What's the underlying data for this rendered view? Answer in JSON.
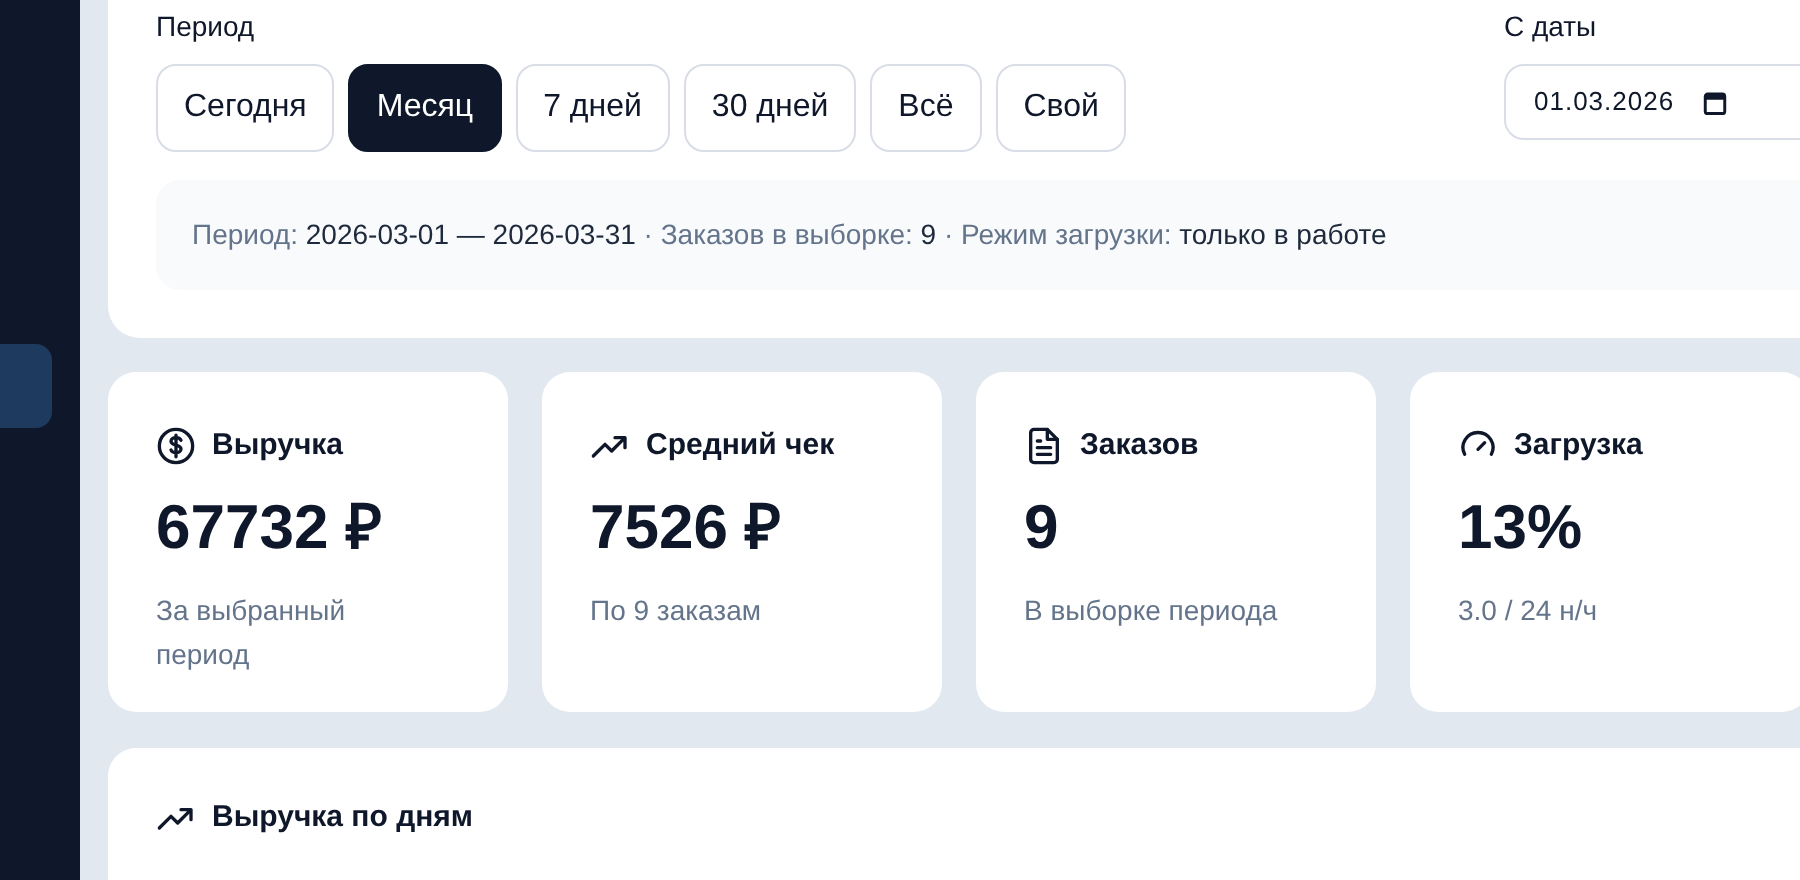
{
  "sidebar": {
    "items": [
      {
        "selected": true
      }
    ]
  },
  "period_filter": {
    "label": "Период",
    "presets": [
      {
        "label": "Сегодня",
        "selected": false
      },
      {
        "label": "Месяц",
        "selected": true
      },
      {
        "label": "7 дней",
        "selected": false
      },
      {
        "label": "30 дней",
        "selected": false
      },
      {
        "label": "Всё",
        "selected": false
      },
      {
        "label": "Свой",
        "selected": false
      }
    ],
    "date_from": {
      "label": "С даты",
      "value": "01.03.2026"
    },
    "summary": [
      {
        "label": "Период:",
        "value": "2026-03-01 — 2026-03-31"
      },
      {
        "label": "· Заказов в выборке:",
        "value": "9"
      },
      {
        "label": "· Режим загрузки:",
        "value": "только в работе"
      }
    ]
  },
  "stats": [
    {
      "kind": "revenue",
      "title": "Выручка",
      "value": "67732 ₽",
      "caption": "За выбранный период"
    },
    {
      "kind": "average",
      "title": "Средний чек",
      "value": "7526 ₽",
      "caption": "По 9 заказам"
    },
    {
      "kind": "orders",
      "title": "Заказов",
      "value": "9",
      "caption": "В выборке периода"
    },
    {
      "kind": "load",
      "title": "Загрузка",
      "value": "13%",
      "caption": "3.0 / 24 н/ч"
    }
  ],
  "revenue_chart": {
    "title": "Выручка по дням"
  }
}
